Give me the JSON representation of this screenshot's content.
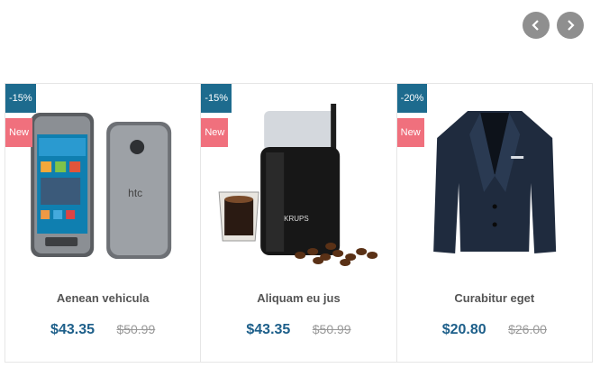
{
  "carousel": {
    "prev_icon": "chevron-left-icon",
    "next_icon": "chevron-right-icon"
  },
  "products": [
    {
      "title": "Aenean vehicula",
      "discount": "-15%",
      "badge": "New",
      "price": "$43.35",
      "old_price": "$50.99",
      "image": "smartphone-image"
    },
    {
      "title": "Aliquam eu jus",
      "discount": "-15%",
      "badge": "New",
      "price": "$43.35",
      "old_price": "$50.99",
      "image": "coffee-grinder-image"
    },
    {
      "title": "Curabitur eget",
      "discount": "-20%",
      "badge": "New",
      "price": "$20.80",
      "old_price": "$26.00",
      "image": "blazer-image"
    }
  ],
  "colors": {
    "discount_badge": "#1d6b8e",
    "new_badge": "#f0707d",
    "price": "#1d5f8a",
    "nav_button": "#8f8f8f"
  }
}
